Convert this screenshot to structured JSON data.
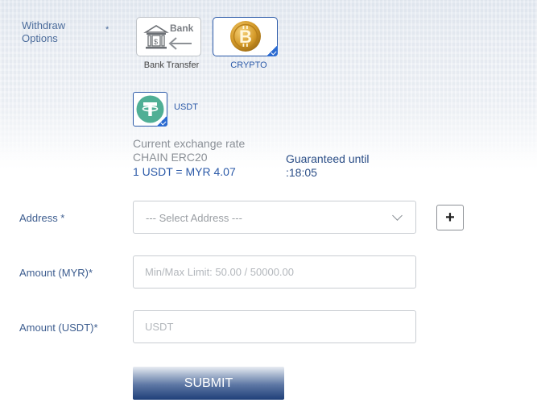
{
  "withdraw": {
    "label": "Withdraw Options",
    "required_mark": "*",
    "options": [
      {
        "label": "Bank Transfer",
        "icon_text": "Bank",
        "icon": "bank-transfer-icon",
        "selected": false
      },
      {
        "label": "CRYPTO",
        "icon": "bitcoin-icon",
        "selected": true
      }
    ]
  },
  "coin": {
    "label": "USDT",
    "icon": "tether-icon",
    "selected": true
  },
  "rate": {
    "title": "Current exchange rate",
    "chain": "CHAIN ERC20",
    "value": "1 USDT = MYR 4.07",
    "guaranteed_label": "Guaranteed until",
    "guaranteed_time": ":18:05"
  },
  "form": {
    "address_label": "Address *",
    "address_placeholder": "--- Select Address ---",
    "add_label": "+",
    "amount_myr_label": "Amount  (MYR)*",
    "amount_myr_placeholder": "Min/Max Limit: 50.00 / 50000.00",
    "amount_usdt_label": "Amount  (USDT)*",
    "amount_usdt_placeholder": "USDT",
    "submit_label": "SUBMIT"
  },
  "colors": {
    "accent": "#2c5aa8",
    "label": "#3d5d8f",
    "tether": "#50af95",
    "bitcoin": "#d59b2a",
    "submit_dark": "#1f3f79"
  }
}
